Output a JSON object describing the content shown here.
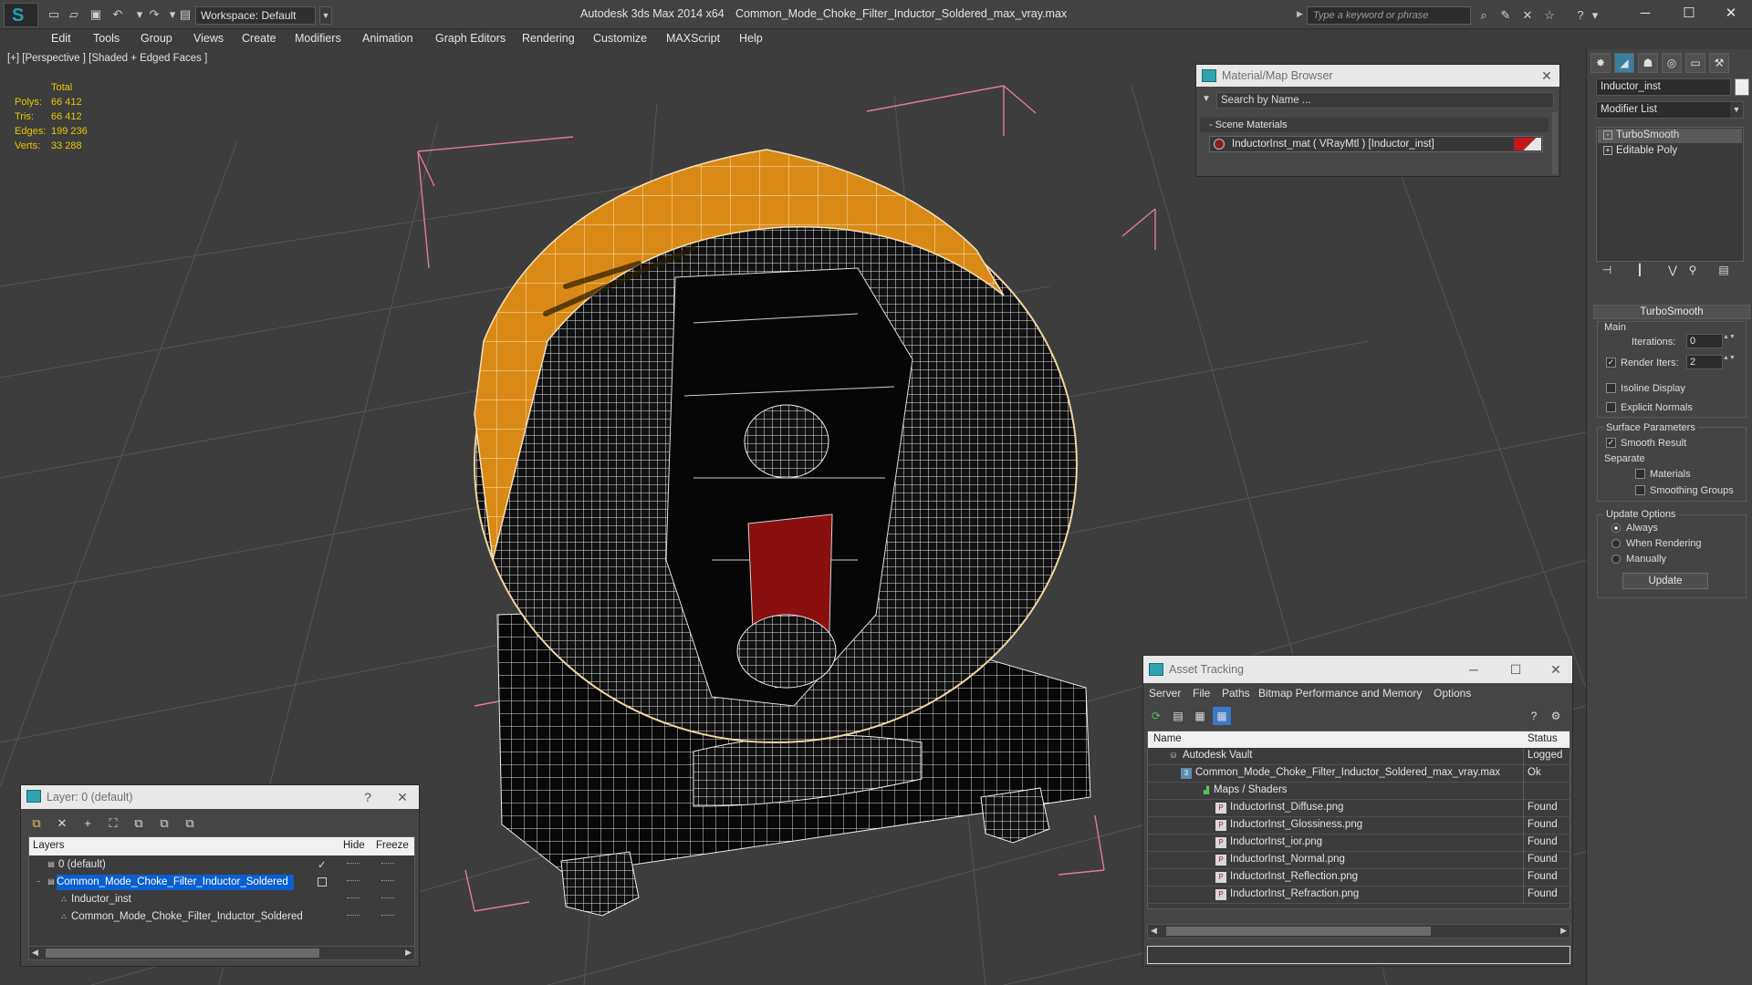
{
  "titlebar": {
    "workspace_label": "Workspace: Default",
    "app_title": "Autodesk 3ds Max  2014 x64",
    "file_title": "Common_Mode_Choke_Filter_Inductor_Soldered_max_vray.max",
    "search_placeholder": "Type a keyword or phrase"
  },
  "menu": [
    "Edit",
    "Tools",
    "Group",
    "Views",
    "Create",
    "Modifiers",
    "Animation",
    "Graph Editors",
    "Rendering",
    "Customize",
    "MAXScript",
    "Help"
  ],
  "viewport": {
    "label": "[+] [Perspective ] [Shaded + Edged Faces ]",
    "stats": {
      "header": "Total",
      "rows": [
        {
          "label": "Polys:",
          "value": "66 412"
        },
        {
          "label": "Tris:",
          "value": "66 412"
        },
        {
          "label": "Edges:",
          "value": "199 236"
        },
        {
          "label": "Verts:",
          "value": "33 288"
        }
      ]
    }
  },
  "material_browser": {
    "title": "Material/Map Browser",
    "search_placeholder": "Search by Name ...",
    "section": "- Scene Materials",
    "item": "InductorInst_mat  ( VRayMtl ) [Inductor_inst]"
  },
  "command_panel": {
    "object_name": "Inductor_inst",
    "modifier_list": "Modifier List",
    "stack": [
      "TurboSmooth",
      "Editable Poly"
    ],
    "rollout": "TurboSmooth",
    "main_label": "Main",
    "iterations_label": "Iterations:",
    "iterations_value": "0",
    "render_iters_label": "Render Iters:",
    "render_iters_value": "2",
    "isoline": "Isoline Display",
    "explicit_normals": "Explicit Normals",
    "surface_params": "Surface Parameters",
    "smooth_result": "Smooth Result",
    "separate": "Separate",
    "materials": "Materials",
    "smoothing_groups": "Smoothing Groups",
    "update_options": "Update Options",
    "always": "Always",
    "when_rendering": "When Rendering",
    "manually": "Manually",
    "update_button": "Update"
  },
  "asset_tracking": {
    "title": "Asset Tracking",
    "menu": [
      "Server",
      "File",
      "Paths",
      "Bitmap Performance and Memory",
      "Options"
    ],
    "col_name": "Name",
    "col_status": "Status",
    "rows": [
      {
        "name": "Autodesk Vault",
        "status": "Logged"
      },
      {
        "name": "Common_Mode_Choke_Filter_Inductor_Soldered_max_vray.max",
        "status": "Ok"
      },
      {
        "name": "Maps / Shaders",
        "status": ""
      },
      {
        "name": "InductorInst_Diffuse.png",
        "status": "Found"
      },
      {
        "name": "InductorInst_Glossiness.png",
        "status": "Found"
      },
      {
        "name": "InductorInst_ior.png",
        "status": "Found"
      },
      {
        "name": "InductorInst_Normal.png",
        "status": "Found"
      },
      {
        "name": "InductorInst_Reflection.png",
        "status": "Found"
      },
      {
        "name": "InductorInst_Refraction.png",
        "status": "Found"
      }
    ]
  },
  "layers": {
    "title": "Layer: 0 (default)",
    "help": "?",
    "col_layers": "Layers",
    "col_hide": "Hide",
    "col_freeze": "Freeze",
    "rows": [
      {
        "name": "0 (default)"
      },
      {
        "name": "Common_Mode_Choke_Filter_Inductor_Soldered"
      },
      {
        "name": "Inductor_inst"
      },
      {
        "name": "Common_Mode_Choke_Filter_Inductor_Soldered"
      }
    ]
  },
  "colors": {
    "accent": "#1ba3b8",
    "selection": "#0a5fd0",
    "stats_text": "#e8c800",
    "band_orange": "#d98a16",
    "core_red": "#8a0f0f"
  }
}
